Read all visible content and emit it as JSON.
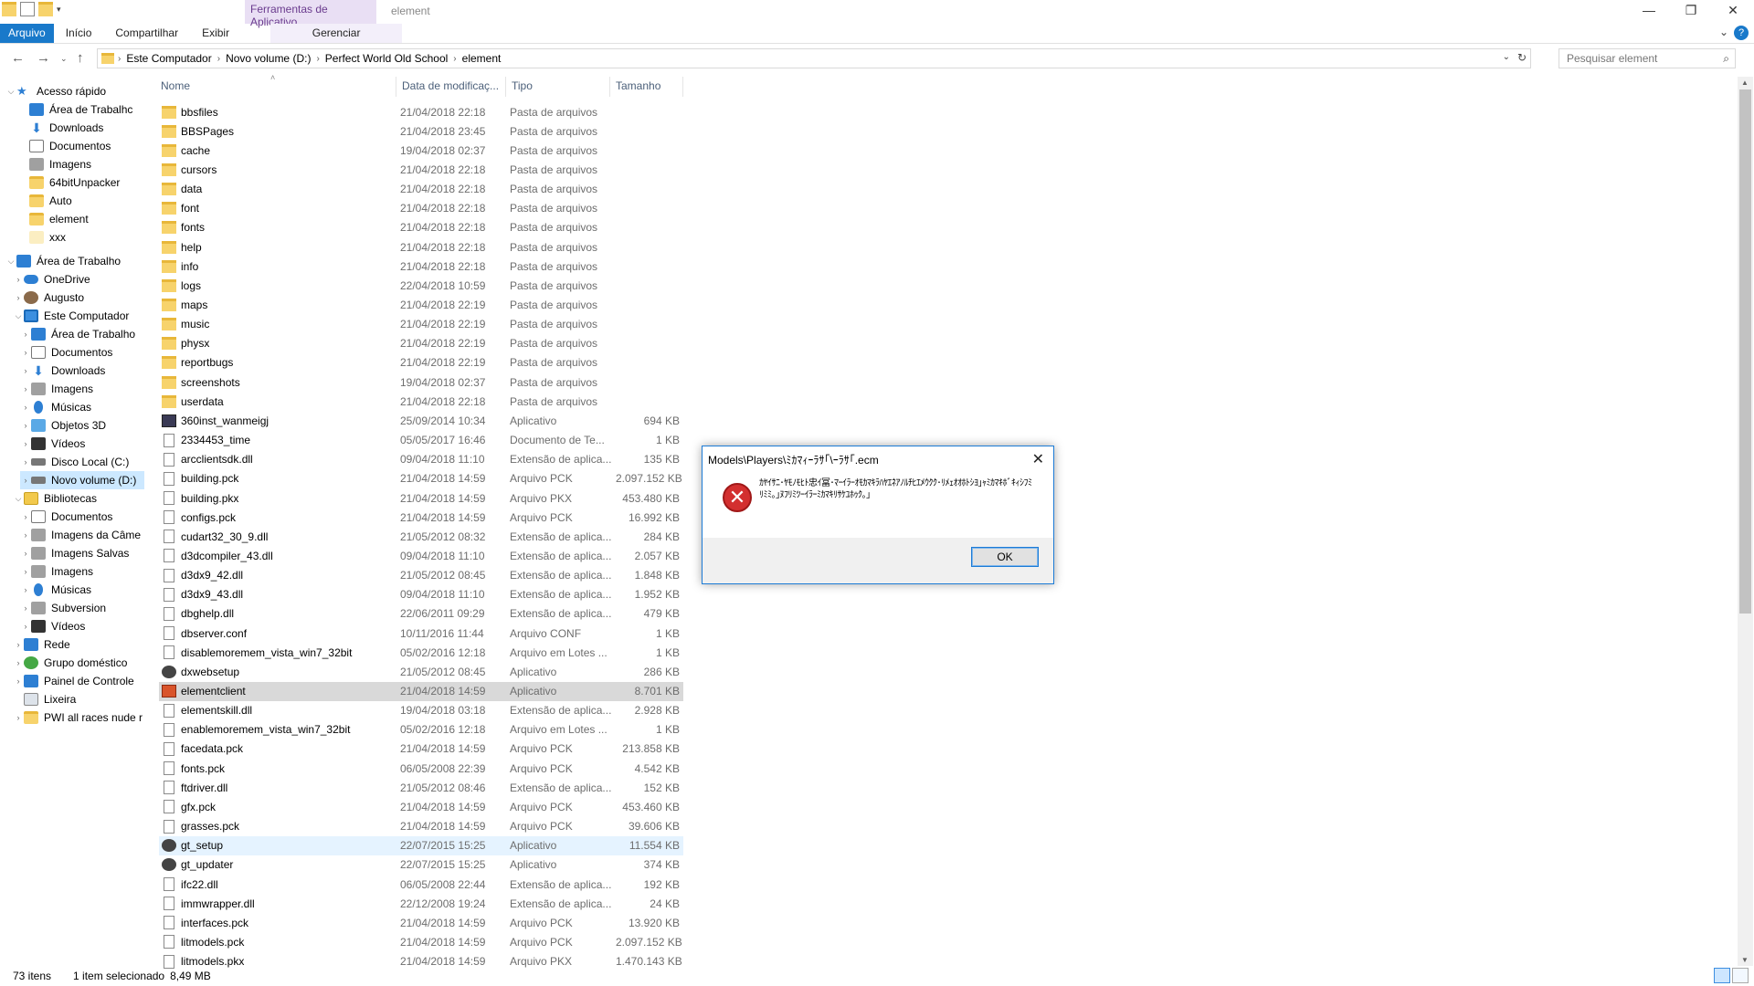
{
  "ribbon": {
    "context_group": "Ferramentas de Aplicativo",
    "window_title": "element",
    "tabs": [
      "Arquivo",
      "Início",
      "Compartilhar",
      "Exibir"
    ],
    "context_tab": "Gerenciar",
    "help": "?",
    "minimize": "—",
    "maximize": "❐",
    "close": "✕"
  },
  "address": {
    "crumbs": [
      "Este Computador",
      "Novo volume (D:)",
      "Perfect World Old School",
      "element"
    ],
    "search_placeholder": "Pesquisar element"
  },
  "sidebar": {
    "quick_access": "Acesso rápido",
    "quick_items": [
      "Área de Trabalhc",
      "Downloads",
      "Documentos",
      "Imagens",
      "64bitUnpacker",
      "Auto",
      "element",
      "xxx"
    ],
    "desktop": "Área de Trabalho",
    "onedrive": "OneDrive",
    "user": "Augusto",
    "this_pc": "Este Computador",
    "pc_items": [
      "Área de Trabalho",
      "Documentos",
      "Downloads",
      "Imagens",
      "Músicas",
      "Objetos 3D",
      "Vídeos",
      "Disco Local (C:)",
      "Novo volume (D:)"
    ],
    "libraries": "Bibliotecas",
    "lib_items": [
      "Documentos",
      "Imagens da Câme",
      "Imagens Salvas",
      "Imagens",
      "Músicas",
      "Subversion",
      "Vídeos"
    ],
    "other_items": [
      "Rede",
      "Grupo doméstico",
      "Painel de Controle",
      "Lixeira",
      "PWI all races nude r"
    ]
  },
  "columns": {
    "name": "Nome",
    "date": "Data de modificaç...",
    "type": "Tipo",
    "size": "Tamanho"
  },
  "files": [
    {
      "name": "bbsfiles",
      "date": "21/04/2018 22:18",
      "type": "Pasta de arquivos",
      "size": "",
      "icon": "folder"
    },
    {
      "name": "BBSPages",
      "date": "21/04/2018 23:45",
      "type": "Pasta de arquivos",
      "size": "",
      "icon": "folder"
    },
    {
      "name": "cache",
      "date": "19/04/2018 02:37",
      "type": "Pasta de arquivos",
      "size": "",
      "icon": "folder"
    },
    {
      "name": "cursors",
      "date": "21/04/2018 22:18",
      "type": "Pasta de arquivos",
      "size": "",
      "icon": "folder"
    },
    {
      "name": "data",
      "date": "21/04/2018 22:18",
      "type": "Pasta de arquivos",
      "size": "",
      "icon": "folder"
    },
    {
      "name": "font",
      "date": "21/04/2018 22:18",
      "type": "Pasta de arquivos",
      "size": "",
      "icon": "folder"
    },
    {
      "name": "fonts",
      "date": "21/04/2018 22:18",
      "type": "Pasta de arquivos",
      "size": "",
      "icon": "folder"
    },
    {
      "name": "help",
      "date": "21/04/2018 22:18",
      "type": "Pasta de arquivos",
      "size": "",
      "icon": "folder"
    },
    {
      "name": "info",
      "date": "21/04/2018 22:18",
      "type": "Pasta de arquivos",
      "size": "",
      "icon": "folder"
    },
    {
      "name": "logs",
      "date": "22/04/2018 10:59",
      "type": "Pasta de arquivos",
      "size": "",
      "icon": "folder"
    },
    {
      "name": "maps",
      "date": "21/04/2018 22:19",
      "type": "Pasta de arquivos",
      "size": "",
      "icon": "folder"
    },
    {
      "name": "music",
      "date": "21/04/2018 22:19",
      "type": "Pasta de arquivos",
      "size": "",
      "icon": "folder"
    },
    {
      "name": "physx",
      "date": "21/04/2018 22:19",
      "type": "Pasta de arquivos",
      "size": "",
      "icon": "folder"
    },
    {
      "name": "reportbugs",
      "date": "21/04/2018 22:19",
      "type": "Pasta de arquivos",
      "size": "",
      "icon": "folder"
    },
    {
      "name": "screenshots",
      "date": "19/04/2018 02:37",
      "type": "Pasta de arquivos",
      "size": "",
      "icon": "folder"
    },
    {
      "name": "userdata",
      "date": "21/04/2018 22:18",
      "type": "Pasta de arquivos",
      "size": "",
      "icon": "folder"
    },
    {
      "name": "360inst_wanmeigj",
      "date": "25/09/2014 10:34",
      "type": "Aplicativo",
      "size": "694 KB",
      "icon": "app"
    },
    {
      "name": "2334453_time",
      "date": "05/05/2017 16:46",
      "type": "Documento de Te...",
      "size": "1 KB",
      "icon": "file"
    },
    {
      "name": "arcclientsdk.dll",
      "date": "09/04/2018 11:10",
      "type": "Extensão de aplica...",
      "size": "135 KB",
      "icon": "file"
    },
    {
      "name": "building.pck",
      "date": "21/04/2018 14:59",
      "type": "Arquivo PCK",
      "size": "2.097.152 KB",
      "icon": "file"
    },
    {
      "name": "building.pkx",
      "date": "21/04/2018 14:59",
      "type": "Arquivo PKX",
      "size": "453.480 KB",
      "icon": "file"
    },
    {
      "name": "configs.pck",
      "date": "21/04/2018 14:59",
      "type": "Arquivo PCK",
      "size": "16.992 KB",
      "icon": "file"
    },
    {
      "name": "cudart32_30_9.dll",
      "date": "21/05/2012 08:32",
      "type": "Extensão de aplica...",
      "size": "284 KB",
      "icon": "file"
    },
    {
      "name": "d3dcompiler_43.dll",
      "date": "09/04/2018 11:10",
      "type": "Extensão de aplica...",
      "size": "2.057 KB",
      "icon": "file"
    },
    {
      "name": "d3dx9_42.dll",
      "date": "21/05/2012 08:45",
      "type": "Extensão de aplica...",
      "size": "1.848 KB",
      "icon": "file"
    },
    {
      "name": "d3dx9_43.dll",
      "date": "09/04/2018 11:10",
      "type": "Extensão de aplica...",
      "size": "1.952 KB",
      "icon": "file"
    },
    {
      "name": "dbghelp.dll",
      "date": "22/06/2011 09:29",
      "type": "Extensão de aplica...",
      "size": "479 KB",
      "icon": "file"
    },
    {
      "name": "dbserver.conf",
      "date": "10/11/2016 11:44",
      "type": "Arquivo CONF",
      "size": "1 KB",
      "icon": "file"
    },
    {
      "name": "disablemoremem_vista_win7_32bit",
      "date": "05/02/2016 12:18",
      "type": "Arquivo em Lotes ...",
      "size": "1 KB",
      "icon": "file"
    },
    {
      "name": "dxwebsetup",
      "date": "21/05/2012 08:45",
      "type": "Aplicativo",
      "size": "286 KB",
      "icon": "appgear"
    },
    {
      "name": "elementclient",
      "date": "21/04/2018 14:59",
      "type": "Aplicativo",
      "size": "8.701 KB",
      "icon": "appred",
      "state": "sel"
    },
    {
      "name": "elementskill.dll",
      "date": "19/04/2018 03:18",
      "type": "Extensão de aplica...",
      "size": "2.928 KB",
      "icon": "file"
    },
    {
      "name": "enablemoremem_vista_win7_32bit",
      "date": "05/02/2016 12:18",
      "type": "Arquivo em Lotes ...",
      "size": "1 KB",
      "icon": "file"
    },
    {
      "name": "facedata.pck",
      "date": "21/04/2018 14:59",
      "type": "Arquivo PCK",
      "size": "213.858 KB",
      "icon": "file"
    },
    {
      "name": "fonts.pck",
      "date": "06/05/2008 22:39",
      "type": "Arquivo PCK",
      "size": "4.542 KB",
      "icon": "file"
    },
    {
      "name": "ftdriver.dll",
      "date": "21/05/2012 08:46",
      "type": "Extensão de aplica...",
      "size": "152 KB",
      "icon": "file"
    },
    {
      "name": "gfx.pck",
      "date": "21/04/2018 14:59",
      "type": "Arquivo PCK",
      "size": "453.460 KB",
      "icon": "file"
    },
    {
      "name": "grasses.pck",
      "date": "21/04/2018 14:59",
      "type": "Arquivo PCK",
      "size": "39.606 KB",
      "icon": "file"
    },
    {
      "name": "gt_setup",
      "date": "22/07/2015 15:25",
      "type": "Aplicativo",
      "size": "11.554 KB",
      "icon": "appgear",
      "state": "hover"
    },
    {
      "name": "gt_updater",
      "date": "22/07/2015 15:25",
      "type": "Aplicativo",
      "size": "374 KB",
      "icon": "appgear"
    },
    {
      "name": "ifc22.dll",
      "date": "06/05/2008 22:44",
      "type": "Extensão de aplica...",
      "size": "192 KB",
      "icon": "file"
    },
    {
      "name": "immwrapper.dll",
      "date": "22/12/2008 19:24",
      "type": "Extensão de aplica...",
      "size": "24 KB",
      "icon": "file"
    },
    {
      "name": "interfaces.pck",
      "date": "21/04/2018 14:59",
      "type": "Arquivo PCK",
      "size": "13.920 KB",
      "icon": "file"
    },
    {
      "name": "litmodels.pck",
      "date": "21/04/2018 14:59",
      "type": "Arquivo PCK",
      "size": "2.097.152 KB",
      "icon": "file"
    },
    {
      "name": "litmodels.pkx",
      "date": "21/04/2018 14:59",
      "type": "Arquivo PKX",
      "size": "1.470.143 KB",
      "icon": "file"
    }
  ],
  "status": {
    "count": "73 itens",
    "selected": "1 item selecionado",
    "size": "8,49 MB"
  },
  "dialog": {
    "title": "Models\\Players\\ﾐｶﾏｨｰﾗｻ｢\\ｰﾗｻ｢.ecm",
    "message": "ｶﾔｲｻﾆ･ﾔﾓﾉﾓﾋﾄ忠ｲ冨･ﾏｰｲﾗｰｵﾓｶﾏｷﾗﾊﾔｴﾈｱﾉﾙﾁﾋｴﾒｳｸｸ･ﾘﾒｪｵｵﾎﾄｼﾖ｣ｬﾐｶﾏｷﾎﾞｷｨｼﾌﾐﾘﾐﾐ｡｣ﾇﾌﾘﾐﾂｰｲﾗｰﾐｶﾏｷﾘｻｹﾕﾎｩｸ｡｣",
    "ok": "OK"
  }
}
